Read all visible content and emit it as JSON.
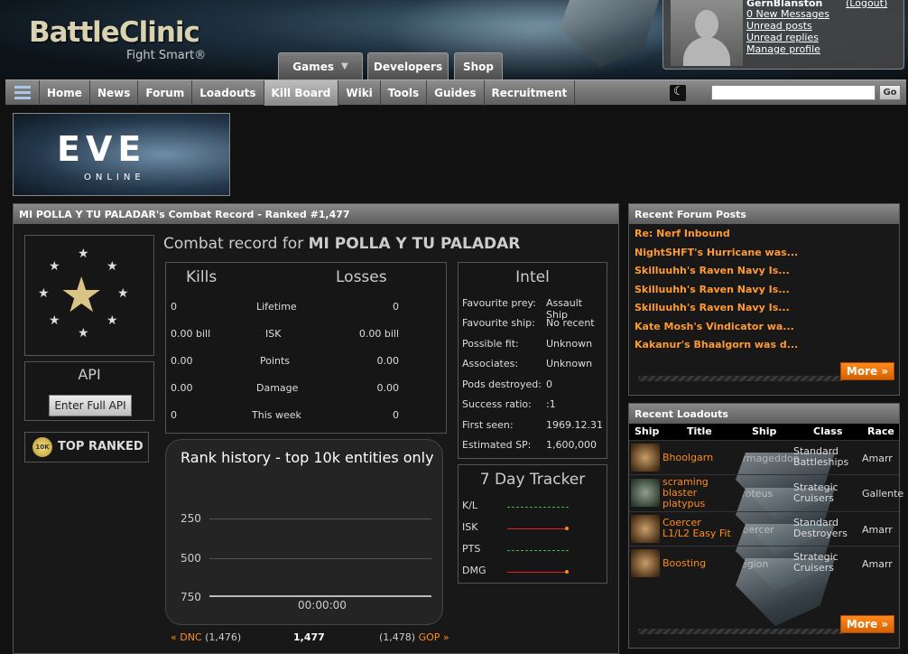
{
  "brand": {
    "name": "BattleClinic",
    "tagline": "Fight Smart®"
  },
  "top_tabs": [
    {
      "label": "Games"
    },
    {
      "label": "Developers"
    },
    {
      "label": "Shop"
    }
  ],
  "user": {
    "name": "GernBlanston",
    "logout": "(Logout)",
    "links": [
      "0 New Messages",
      "Unread posts",
      "Unread replies",
      "Manage profile"
    ]
  },
  "nav": {
    "items": [
      "Home",
      "News",
      "Forum",
      "Loadouts",
      "Kill Board",
      "Wiki",
      "Tools",
      "Guides",
      "Recruitment"
    ],
    "active": "Kill Board",
    "search_placeholder": "",
    "go": "Go"
  },
  "banner": {
    "logo": "EVE",
    "sub": "ONLINE"
  },
  "record": {
    "title": "MI POLLA Y TU PALADAR's Combat Record - Ranked #1,477",
    "heading_prefix": "Combat record for",
    "heading_name": "MI POLLA Y TU PALADAR",
    "api_title": "API",
    "api_button": "Enter Full API",
    "top_ranked": "TOP RANKED",
    "top_ranked_badge": "10K",
    "kills_label": "Kills",
    "losses_label": "Losses",
    "rows": [
      {
        "kills": "0",
        "label": "Lifetime",
        "losses": "0"
      },
      {
        "kills": "0.00 bill",
        "label": "ISK",
        "losses": "0.00 bill"
      },
      {
        "kills": "0.00",
        "label": "Points",
        "losses": "0.00"
      },
      {
        "kills": "0.00",
        "label": "Damage",
        "losses": "0.00"
      },
      {
        "kills": "0",
        "label": "This week",
        "losses": "0"
      }
    ],
    "intel_title": "Intel",
    "intel": [
      {
        "label": "Favourite prey:",
        "value": "Assault Ship"
      },
      {
        "label": "Favourite ship:",
        "value": "No recent"
      },
      {
        "label": "Possible fit:",
        "value": "Unknown"
      },
      {
        "label": "Associates:",
        "value": "Unknown"
      },
      {
        "label": "Pods destroyed:",
        "value": "0"
      },
      {
        "label": "Success ratio:",
        "value": ":1"
      },
      {
        "label": "First seen:",
        "value": "1969.12.31"
      },
      {
        "label": "Estimated SP:",
        "value": "1,600,000"
      }
    ],
    "graph_title": "Rank history - top 10k entities only",
    "graph_ticks": [
      "250",
      "500",
      "750"
    ],
    "graph_time": "00:00:00",
    "rank_nav": {
      "prev_label": "« DNC",
      "prev_rank": "(1,476)",
      "current": "1,477",
      "next_rank": "(1,478)",
      "next_label": "GOP »"
    },
    "tracker_title": "7 Day Tracker",
    "tracker_rows": [
      "K/L",
      "ISK",
      "PTS",
      "DMG"
    ]
  },
  "forum": {
    "title": "Recent Forum Posts",
    "posts": [
      "Re: Nerf Inbound",
      "NightSHFT's Hurricane was...",
      "Skilluuhh's Raven Navy Is...",
      "Skilluuhh's Raven Navy Is...",
      "Skilluuhh's Raven Navy Is...",
      "Kate Mosh's Vindicator wa...",
      "Kakanur's Bhaalgorn was d..."
    ],
    "more": "More »"
  },
  "loadouts": {
    "title": "Recent Loadouts",
    "headers": [
      "Ship",
      "Title",
      "Ship",
      "Class",
      "Race"
    ],
    "rows": [
      {
        "title": "Bhoolgarn",
        "ship": "Armageddon",
        "class": "Standard Battleships",
        "race": "Amarr"
      },
      {
        "title": "scraming blaster platypus",
        "ship": "Proteus",
        "class": "Strategic Cruisers",
        "race": "Gallente"
      },
      {
        "title": "Coercer L1/L2 Easy Fit",
        "ship": "Coercer",
        "class": "Standard Destroyers",
        "race": "Amarr"
      },
      {
        "title": "Boosting",
        "ship": "Legion",
        "class": "Strategic Cruisers",
        "race": "Amarr"
      }
    ],
    "more": "More »"
  },
  "colors": {
    "accent": "#ff8c1a",
    "panel": "#181818"
  }
}
